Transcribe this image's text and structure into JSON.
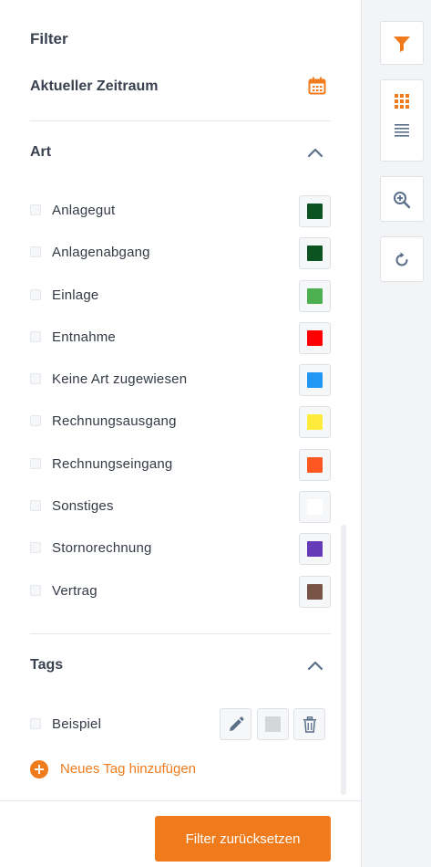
{
  "panel": {
    "title": "Filter",
    "period_label": "Aktueller Zeitraum",
    "period_icon": "calendar-icon"
  },
  "art": {
    "heading": "Art",
    "items": [
      {
        "label": "Anlagegut",
        "color": "#0b5320"
      },
      {
        "label": "Anlagenabgang",
        "color": "#0b5320"
      },
      {
        "label": "Einlage",
        "color": "#4caf50"
      },
      {
        "label": "Entnahme",
        "color": "#ff0000"
      },
      {
        "label": "Keine Art zugewiesen",
        "color": "#2196f3"
      },
      {
        "label": "Rechnungsausgang",
        "color": "#ffeb3b"
      },
      {
        "label": "Rechnungseingang",
        "color": "#ff5722"
      },
      {
        "label": "Sonstiges",
        "color": "#ffffff"
      },
      {
        "label": "Stornorechnung",
        "color": "#673ab7"
      },
      {
        "label": "Vertrag",
        "color": "#795548"
      }
    ]
  },
  "tags": {
    "heading": "Tags",
    "items": [
      {
        "label": "Beispiel",
        "color": "#d4d6d9"
      }
    ],
    "add_label": "Neues Tag hinzufügen"
  },
  "footer": {
    "reset_label": "Filter zurücksetzen"
  },
  "rail": {
    "tools": [
      "filter-icon",
      "grid-view-icon",
      "list-view-icon",
      "zoom-in-icon",
      "refresh-icon"
    ]
  },
  "colors": {
    "accent": "#f07b1c",
    "text": "#333a45",
    "icon_blue": "#5b6f8a"
  }
}
